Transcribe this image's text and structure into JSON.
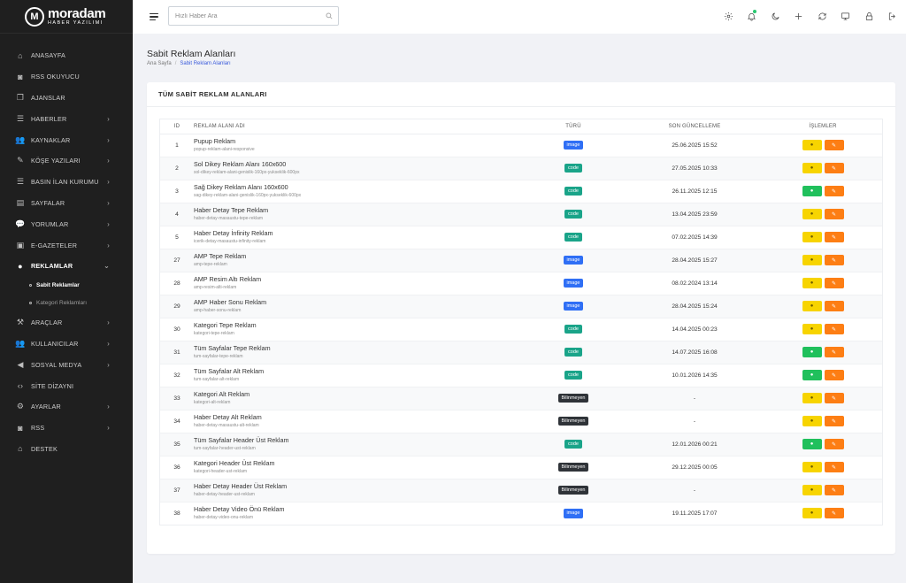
{
  "brand": {
    "logo_letters": "M",
    "name": "moradam",
    "subtitle": "HABER YAZILIMI"
  },
  "sidebar": {
    "items": [
      {
        "label": "ANASAYFA",
        "icon": "home-icon",
        "chevron": false
      },
      {
        "label": "RSS OKUYUCU",
        "icon": "rss-icon",
        "chevron": false
      },
      {
        "label": "AJANSLAR",
        "icon": "copy-icon",
        "chevron": false
      },
      {
        "label": "HABERLER",
        "icon": "list-icon",
        "chevron": true
      },
      {
        "label": "KAYNAKLAR",
        "icon": "users-icon",
        "chevron": true
      },
      {
        "label": "KÖŞE YAZILARI",
        "icon": "pen-icon",
        "chevron": true
      },
      {
        "label": "BASIN İLAN KURUMU",
        "icon": "list-icon",
        "chevron": true
      },
      {
        "label": "SAYFALAR",
        "icon": "pages-icon",
        "chevron": true
      },
      {
        "label": "YORUMLAR",
        "icon": "comment-icon",
        "chevron": true
      },
      {
        "label": "E-GAZETELER",
        "icon": "newspaper-icon",
        "chevron": true
      },
      {
        "label": "REKLAMLAR",
        "icon": "ad-icon",
        "chevron": true,
        "active": true,
        "expanded": true
      },
      {
        "label": "ARAÇLAR",
        "icon": "tools-icon",
        "chevron": true
      },
      {
        "label": "KULLANICILAR",
        "icon": "users-icon",
        "chevron": true
      },
      {
        "label": "SOSYAL MEDYA",
        "icon": "share-icon",
        "chevron": true
      },
      {
        "label": "SİTE DİZAYNI",
        "icon": "code-icon",
        "chevron": false
      },
      {
        "label": "AYARLAR",
        "icon": "gear-icon",
        "chevron": true
      },
      {
        "label": "RSS",
        "icon": "rss-icon",
        "chevron": true
      },
      {
        "label": "DESTEK",
        "icon": "support-icon",
        "chevron": false
      }
    ],
    "submenu": [
      {
        "label": "Sabit Reklamlar",
        "active": true
      },
      {
        "label": "Kategori Reklamları",
        "active": false
      }
    ]
  },
  "topbar": {
    "search_placeholder": "Hızlı Haber Ara",
    "icons": [
      "gear-icon",
      "bell-icon",
      "moon-icon",
      "plus-icon",
      "refresh-icon",
      "monitor-icon",
      "lock-icon",
      "logout-icon"
    ]
  },
  "page": {
    "title": "Sabit Reklam Alanları",
    "breadcrumb": [
      "Ana Sayfa",
      "Sabit Reklam Alanları"
    ]
  },
  "card": {
    "title": "TÜM SABİT REKLAM ALANLARI"
  },
  "table": {
    "headers": {
      "id": "ID",
      "name": "REKLAM ALANI ADI",
      "type": "TÜRÜ",
      "updated": "SON GÜNCELLEME",
      "actions": "İŞLEMLER"
    },
    "rows": [
      {
        "id": "1",
        "name": "Pupup Reklam",
        "slug": "popup-reklam-alani-responsive",
        "type": "image",
        "type_label": "image",
        "updated": "25.06.2025 15:52",
        "view_green": false
      },
      {
        "id": "2",
        "name": "Sol Dikey Reklam Alanı 160x600",
        "slug": "sol-dikey-reklam-alani-genislik-160px-yukseklik-600px",
        "type": "code",
        "type_label": "code",
        "updated": "27.05.2025 10:33",
        "view_green": false
      },
      {
        "id": "3",
        "name": "Sağ Dikey Reklam Alanı 160x600",
        "slug": "sag-dikey-reklam-alani-genislik-160px-yukseklik-600px",
        "type": "code",
        "type_label": "code",
        "updated": "26.11.2025 12:15",
        "view_green": true
      },
      {
        "id": "4",
        "name": "Haber Detay Tepe Reklam",
        "slug": "haber-detay-masaustu-tepe-reklam",
        "type": "code",
        "type_label": "code",
        "updated": "13.04.2025 23:59",
        "view_green": false
      },
      {
        "id": "5",
        "name": "Haber Detay İnfinity Reklam",
        "slug": "icerik-detay-masaustu-infinity-reklam",
        "type": "code",
        "type_label": "code",
        "updated": "07.02.2025 14:39",
        "view_green": false
      },
      {
        "id": "27",
        "name": "AMP Tepe Reklam",
        "slug": "amp-tepe-reklam",
        "type": "image",
        "type_label": "image",
        "updated": "28.04.2025 15:27",
        "view_green": false
      },
      {
        "id": "28",
        "name": "AMP Resim Altı Reklam",
        "slug": "amp-resim-alti-reklam",
        "type": "image",
        "type_label": "image",
        "updated": "08.02.2024 13:14",
        "view_green": false
      },
      {
        "id": "29",
        "name": "AMP Haber Sonu Reklam",
        "slug": "amp-haber-sonu-reklam",
        "type": "image",
        "type_label": "image",
        "updated": "28.04.2025 15:24",
        "view_green": false
      },
      {
        "id": "30",
        "name": "Kategori Tepe Reklam",
        "slug": "kategori-tepe-reklam",
        "type": "code",
        "type_label": "code",
        "updated": "14.04.2025 00:23",
        "view_green": false
      },
      {
        "id": "31",
        "name": "Tüm Sayfalar Tepe Reklam",
        "slug": "tum-sayfalar-tepe-reklam",
        "type": "code",
        "type_label": "code",
        "updated": "14.07.2025 16:08",
        "view_green": true
      },
      {
        "id": "32",
        "name": "Tüm Sayfalar Alt Reklam",
        "slug": "tum-sayfalar-alt-reklam",
        "type": "code",
        "type_label": "code",
        "updated": "10.01.2026 14:35",
        "view_green": true
      },
      {
        "id": "33",
        "name": "Kategori Alt Reklam",
        "slug": "kategori-alt-reklam",
        "type": "unknown",
        "type_label": "Bilinmeyen",
        "updated": "-",
        "view_green": false
      },
      {
        "id": "34",
        "name": "Haber Detay Alt Reklam",
        "slug": "haber-detay-masaustu-alt-reklam",
        "type": "unknown",
        "type_label": "Bilinmeyen",
        "updated": "-",
        "view_green": false
      },
      {
        "id": "35",
        "name": "Tüm Sayfalar Header Üst Reklam",
        "slug": "tum-sayfalar-header-ust-reklam",
        "type": "code",
        "type_label": "code",
        "updated": "12.01.2026 00:21",
        "view_green": true
      },
      {
        "id": "36",
        "name": "Kategori Header Üst Reklam",
        "slug": "kategori-header-ust-reklam",
        "type": "unknown",
        "type_label": "Bilinmeyen",
        "updated": "29.12.2025 00:05",
        "view_green": false
      },
      {
        "id": "37",
        "name": "Haber Detay Header Üst Reklam",
        "slug": "haber-detay-header-ust-reklam",
        "type": "unknown",
        "type_label": "Bilinmeyen",
        "updated": "-",
        "view_green": false
      },
      {
        "id": "38",
        "name": "Haber Detay Video Önü Reklam",
        "slug": "haber-detay-video-onu-reklam",
        "type": "image",
        "type_label": "image",
        "updated": "19.11.2025 17:07",
        "view_green": false
      }
    ]
  },
  "colors": {
    "sidebar_bg": "#1f1f1f",
    "accent_blue": "#2f6ff5",
    "code_green": "#1aa489",
    "unknown_dark": "#2f3338",
    "view_yellow": "#f7d400",
    "view_green": "#20c05c",
    "edit_orange": "#fd7e14"
  }
}
